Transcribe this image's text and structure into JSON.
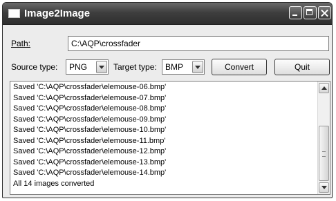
{
  "window": {
    "title": "Image2Image"
  },
  "form": {
    "path_label": "Path:",
    "path_value": "C:\\AQP\\crossfader",
    "source_label": "Source type:",
    "source_value": "PNG",
    "target_label": "Target type:",
    "target_value": "BMP",
    "convert_label": "Convert",
    "quit_label": "Quit"
  },
  "log": {
    "lines": [
      "Saved 'C:\\AQP\\crossfader\\elemouse-06.bmp'",
      "Saved 'C:\\AQP\\crossfader\\elemouse-07.bmp'",
      "Saved 'C:\\AQP\\crossfader\\elemouse-08.bmp'",
      "Saved 'C:\\AQP\\crossfader\\elemouse-09.bmp'",
      "Saved 'C:\\AQP\\crossfader\\elemouse-10.bmp'",
      "Saved 'C:\\AQP\\crossfader\\elemouse-11.bmp'",
      "Saved 'C:\\AQP\\crossfader\\elemouse-12.bmp'",
      "Saved 'C:\\AQP\\crossfader\\elemouse-13.bmp'",
      "Saved 'C:\\AQP\\crossfader\\elemouse-14.bmp'",
      "All 14 images converted"
    ]
  },
  "icons": {
    "app": "window-icon",
    "minimize": "minimize-icon",
    "maximize": "maximize-icon",
    "close": "close-icon",
    "dropdown": "chevron-down-icon",
    "scroll_up": "scroll-up-arrow-icon",
    "scroll_down": "scroll-down-arrow-icon"
  }
}
